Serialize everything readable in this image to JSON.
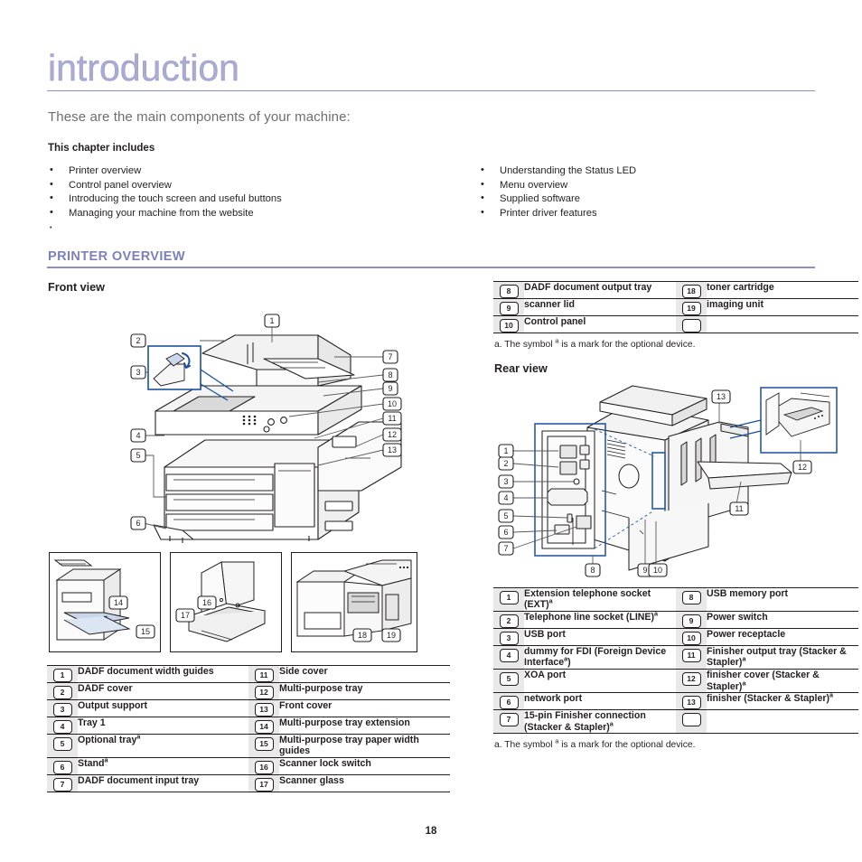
{
  "document": {
    "chapter_title": "introduction",
    "subtitle": "These are the main components of your machine:",
    "chapter_includes_label": "This chapter includes",
    "page_number": "18",
    "accent_color": "#7d81bb",
    "title_color": "#a9abd4",
    "rule_color": "#8d90c4",
    "numcell_bg": "#e9e9e9",
    "text_color": "#231f20",
    "callout_blue": "#1b4fa0"
  },
  "chapter_includes": {
    "left": [
      "Printer overview",
      "Control panel overview",
      "Introducing the touch screen and useful buttons",
      "Managing your machine from the website",
      ""
    ],
    "right": [
      "Understanding the Status LED",
      "Menu overview",
      "Supplied software",
      "Printer driver features"
    ]
  },
  "section": {
    "heading": "PRINTER OVERVIEW",
    "front_view_heading": "Front view",
    "rear_view_heading": "Rear view"
  },
  "footnote": {
    "prefix": "a. The symbol ",
    "marker": "a",
    "suffix": " is a mark for the optional device."
  },
  "front_table_top": {
    "rows": [
      {
        "left_num": "8",
        "left_text": "DADF document output tray",
        "right_num": "18",
        "right_text": "toner cartridge"
      },
      {
        "left_num": "9",
        "left_text": "scanner lid",
        "right_num": "19",
        "right_text": "imaging unit"
      },
      {
        "left_num": "10",
        "left_text": "Control panel",
        "right_num": "",
        "right_text": ""
      }
    ]
  },
  "front_table_main": {
    "rows": [
      {
        "left_num": "1",
        "left_text": "DADF document width guides",
        "right_num": "11",
        "right_text": "Side cover"
      },
      {
        "left_num": "2",
        "left_text": "DADF cover",
        "right_num": "12",
        "right_text": "Multi-purpose tray"
      },
      {
        "left_num": "3",
        "left_text": "Output support",
        "right_num": "13",
        "right_text": "Front cover"
      },
      {
        "left_num": "4",
        "left_text": "Tray 1",
        "right_num": "14",
        "right_text": "Multi-purpose tray extension"
      },
      {
        "left_num": "5",
        "left_text": "Optional tray",
        "left_sup": "a",
        "right_num": "15",
        "right_text": "Multi-purpose tray paper width guides"
      },
      {
        "left_num": "6",
        "left_text": "Stand",
        "left_sup": "a",
        "right_num": "16",
        "right_text": "Scanner lock switch"
      },
      {
        "left_num": "7",
        "left_text": "DADF document input tray",
        "right_num": "17",
        "right_text": "Scanner glass"
      }
    ]
  },
  "rear_table": {
    "rows": [
      {
        "left_num": "1",
        "left_text": "Extension telephone socket (EXT)",
        "left_sup": "a",
        "right_num": "8",
        "right_text": "USB memory port"
      },
      {
        "left_num": "2",
        "left_text": "Telephone line socket (LINE)",
        "left_sup": "a",
        "right_num": "9",
        "right_text": "Power switch"
      },
      {
        "left_num": "3",
        "left_text": "USB port",
        "right_num": "10",
        "right_text": "Power receptacle"
      },
      {
        "left_num": "4",
        "left_text": "dummy for FDI (Foreign Device Interface",
        "left_sup": "a",
        "left_tail": ")",
        "right_num": "11",
        "right_text": "Finisher output tray (Stacker & Stapler)",
        "right_sup": "a"
      },
      {
        "left_num": "5",
        "left_text": "XOA port",
        "right_num": "12",
        "right_text": "finisher cover (Stacker & Stapler)",
        "right_sup": "a"
      },
      {
        "left_num": "6",
        "left_text": "network port",
        "right_num": "13",
        "right_text": "finisher (Stacker & Stapler)",
        "right_sup": "a"
      },
      {
        "left_num": "7",
        "left_text": "15-pin Finisher connection (Stacker & Stapler)",
        "left_sup": "a",
        "right_num": "",
        "right_text": ""
      }
    ]
  },
  "front_illustration": {
    "callouts": [
      "1",
      "2",
      "3",
      "4",
      "5",
      "6",
      "7",
      "8",
      "9",
      "10",
      "11",
      "12",
      "13"
    ]
  },
  "front_thumbnails": {
    "thumb1_callouts": [
      "14",
      "15"
    ],
    "thumb2_callouts": [
      "16",
      "17"
    ],
    "thumb3_callouts": [
      "18",
      "19"
    ]
  },
  "rear_illustration": {
    "callouts": [
      "1",
      "2",
      "3",
      "4",
      "5",
      "6",
      "7",
      "8",
      "9",
      "10",
      "11",
      "12",
      "13"
    ]
  }
}
